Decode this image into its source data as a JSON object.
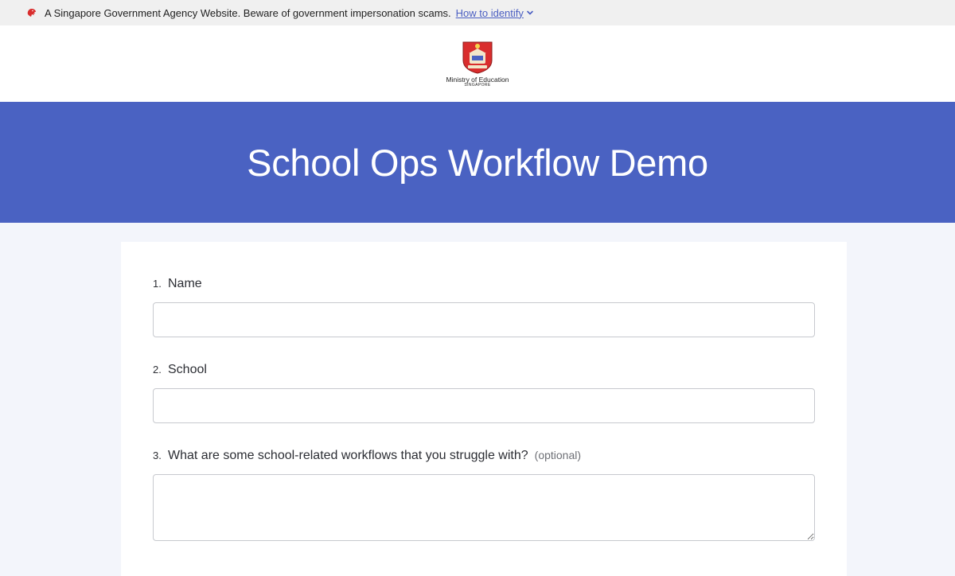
{
  "masthead": {
    "notice": "A Singapore Government Agency Website. Beware of government impersonation scams.",
    "link_label": "How to identify",
    "icon": "singapore-lion-icon"
  },
  "logo": {
    "name": "Ministry of Education",
    "sub": "SINGAPORE",
    "icon": "moe-crest-icon"
  },
  "hero": {
    "title": "School Ops Workflow Demo",
    "background": "#4a62c2"
  },
  "form": {
    "questions": [
      {
        "number": "1.",
        "label": "Name",
        "optional": "",
        "value": ""
      },
      {
        "number": "2.",
        "label": "School",
        "optional": "",
        "value": ""
      },
      {
        "number": "3.",
        "label": "What are some school-related workflows that you struggle with?",
        "optional": "(optional)",
        "value": ""
      }
    ]
  },
  "colors": {
    "accent": "#4a62c2",
    "page_bg": "#f3f5fb",
    "masthead_bg": "#f0f0f0",
    "crest_red": "#d92d2d"
  }
}
